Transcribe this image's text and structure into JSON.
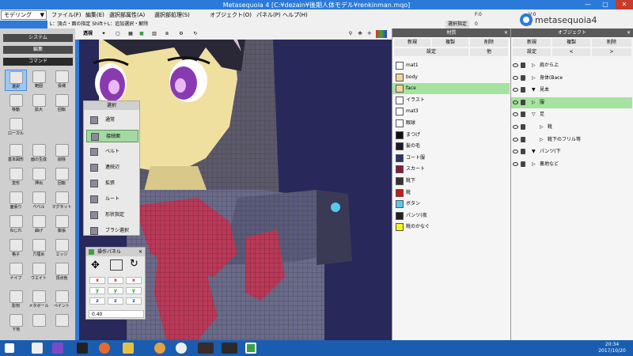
{
  "window": {
    "title": "Metasequoia 4 [C:¥dezain¥後期人体モデル¥renkinman.mqo]"
  },
  "menu": {
    "mode": "モデリング",
    "items": [
      "ファイル(F)",
      "編集(E)",
      "選択部属性(A)",
      "選択部処理(S)",
      "オブジェクト(O)",
      "パネル(P)",
      "ヘルプ(H)"
    ]
  },
  "info": {
    "hint": "L：頂点・面の指定  Shift＋L：追加選択・解除",
    "reset": "選択指定"
  },
  "coords": {
    "f": "F:0",
    "v": "V:0",
    "zero": "0",
    "zero2": "0"
  },
  "logo": "metasequoia4",
  "left": {
    "system": "システム",
    "edit": "編集",
    "command": "コマンド",
    "tools": [
      {
        "label": "選択",
        "icon": "arrow-icon"
      },
      {
        "label": "範囲",
        "icon": "rect-select-icon"
      },
      {
        "label": "投縄",
        "icon": "lasso-icon"
      },
      {
        "label": "移動",
        "icon": "move-icon"
      },
      {
        "label": "拡大",
        "icon": "scale-icon"
      },
      {
        "label": "回転",
        "icon": "rotate-icon"
      },
      {
        "label": "ローカル",
        "icon": "local-icon"
      },
      {
        "label": "基本図形",
        "icon": "primitive-icon"
      },
      {
        "label": "面の生成",
        "icon": "face-gen-icon"
      },
      {
        "label": "削除",
        "icon": "delete-icon"
      },
      {
        "label": "変形",
        "icon": "deform-icon"
      },
      {
        "label": "押出",
        "icon": "extrude-icon"
      },
      {
        "label": "回転",
        "icon": "lathe-icon"
      },
      {
        "label": "面張り",
        "icon": "face-icon"
      },
      {
        "label": "ベベル",
        "icon": "bevel-icon"
      },
      {
        "label": "マグネット",
        "icon": "magnet-icon"
      },
      {
        "label": "ねじれ",
        "icon": "twist-icon"
      },
      {
        "label": "曲げ",
        "icon": "bend-icon"
      },
      {
        "label": "膨張",
        "icon": "inflate-icon"
      },
      {
        "label": "格子",
        "icon": "lattice-icon"
      },
      {
        "label": "穴埋め",
        "icon": "hole-icon"
      },
      {
        "label": "エッジ",
        "icon": "edge-icon"
      },
      {
        "label": "ナイフ",
        "icon": "knife-icon"
      },
      {
        "label": "ウエイト",
        "icon": "weight-icon"
      },
      {
        "label": "頂点色",
        "icon": "vcolor-icon"
      },
      {
        "label": "彫刻",
        "icon": "sculpt-icon"
      },
      {
        "label": "メタボール",
        "icon": "metaball-icon"
      },
      {
        "label": "ペイント",
        "icon": "paint-icon"
      },
      {
        "label": "下地",
        "icon": "underlay-icon"
      },
      {
        "label": "",
        "icon": "export-icon"
      },
      {
        "label": "",
        "icon": "camera-icon"
      }
    ]
  },
  "viewtool": {
    "persp": "透視"
  },
  "selection": {
    "title": "選択",
    "items": [
      "通常",
      "接続面",
      "ベルト",
      "連続辺",
      "拡張",
      "ルート",
      "形状指定",
      "ブラシ選択"
    ],
    "selected": 1
  },
  "oppanel": {
    "title": "操作パネル",
    "x": "x",
    "y": "y",
    "z": "z",
    "value": "0.40"
  },
  "materials": {
    "title": "材質",
    "new": "新規",
    "dup": "複製",
    "del": "削除",
    "settings": "設定",
    "other": "他",
    "items": [
      {
        "name": "mat1",
        "color": "#ffffff"
      },
      {
        "name": "body",
        "color": "#f5d49c"
      },
      {
        "name": "face",
        "color": "#f6d4a0"
      },
      {
        "name": "イラスト",
        "color": "#ffffff"
      },
      {
        "name": "mat3",
        "color": "#ffffff"
      },
      {
        "name": "眼球",
        "color": "#ffffff"
      },
      {
        "name": "まつげ",
        "color": "#111111"
      },
      {
        "name": "髪の毛",
        "color": "#1a1a2a"
      },
      {
        "name": "コート服",
        "color": "#2b3570"
      },
      {
        "name": "スカート",
        "color": "#8a1a3a"
      },
      {
        "name": "靴下",
        "color": "#333333"
      },
      {
        "name": "靴",
        "color": "#c81a1a"
      },
      {
        "name": "ボタン",
        "color": "#58c8f0"
      },
      {
        "name": "パンツ(夜",
        "color": "#222222"
      },
      {
        "name": "靴のかなぐ",
        "color": "#f5f51a"
      }
    ],
    "selected": 2
  },
  "objects": {
    "title": "オブジェクト",
    "new": "新規",
    "dup": "複製",
    "del": "削除",
    "settings": "設定",
    "prev": "<",
    "next": ">",
    "items": [
      {
        "name": "肩から上",
        "indent": 0,
        "arrow": "▷"
      },
      {
        "name": "身体(Bace",
        "indent": 0,
        "arrow": "▷"
      },
      {
        "name": "見本",
        "indent": 0,
        "arrow": "▼"
      },
      {
        "name": "服",
        "indent": 0,
        "arrow": "▷"
      },
      {
        "name": "足",
        "indent": 0,
        "arrow": "▽"
      },
      {
        "name": "靴",
        "indent": 1,
        "arrow": "▷"
      },
      {
        "name": "靴下のフリル等",
        "indent": 1,
        "arrow": "▷"
      },
      {
        "name": "パンツ(下",
        "indent": 0,
        "arrow": "▼"
      },
      {
        "name": "裏地など",
        "indent": 0,
        "arrow": "▷"
      }
    ],
    "selected": 3
  },
  "taskbar": {
    "time": "20:34",
    "date": "2017/10/20"
  }
}
